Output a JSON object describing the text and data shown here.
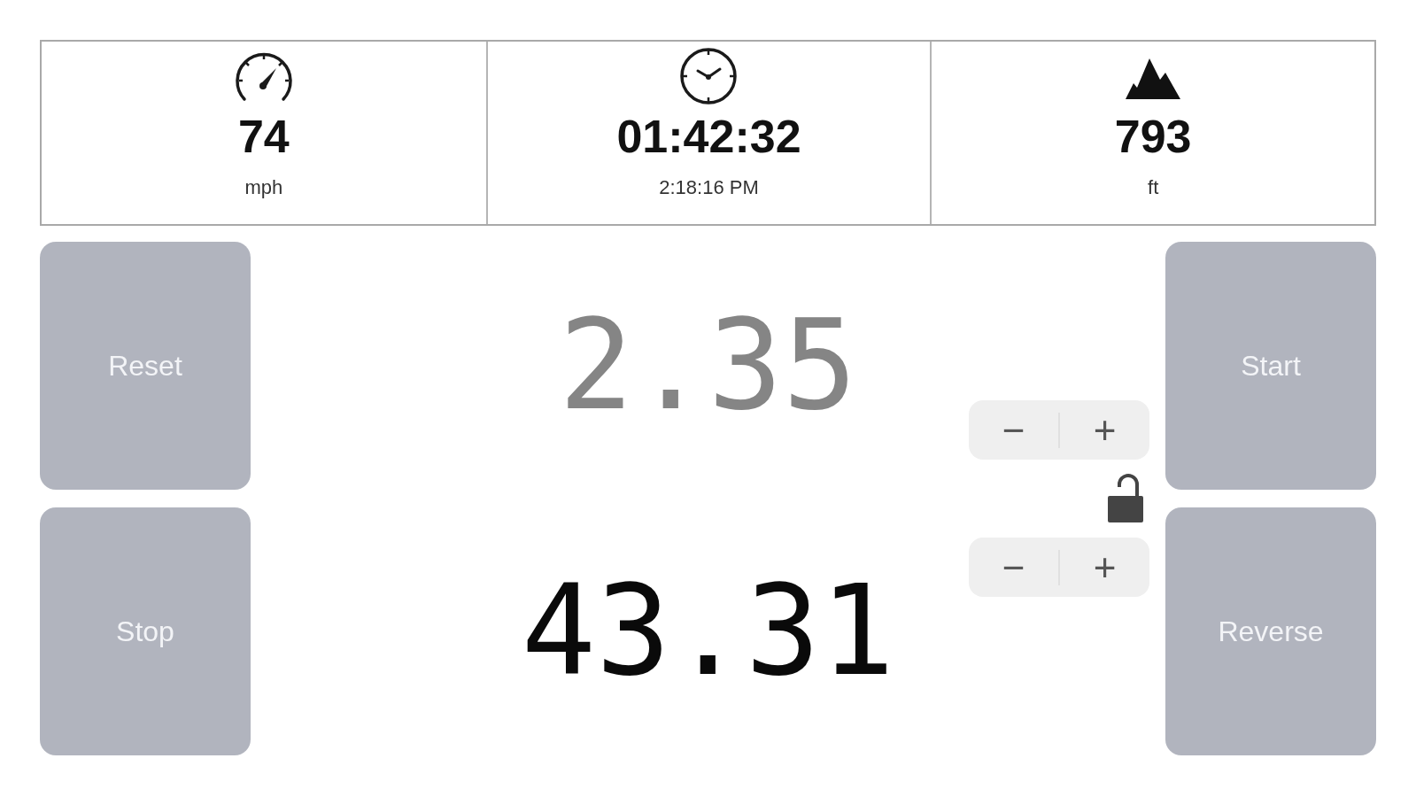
{
  "stats": [
    {
      "kind": "speed",
      "value": "74",
      "unit": "mph"
    },
    {
      "kind": "clock",
      "value": "01:42:32",
      "unit": "2:18:16 PM"
    },
    {
      "kind": "elevation",
      "value": "793",
      "unit": "ft"
    }
  ],
  "left_buttons": [
    "Reset",
    "Stop"
  ],
  "readouts": [
    {
      "value": "2.35",
      "dimmed": true
    },
    {
      "value": "43.31",
      "dimmed": false
    }
  ],
  "steppers": [
    {
      "minus": "−",
      "plus": "+"
    },
    {
      "minus": "−",
      "plus": "+"
    }
  ],
  "lock": {
    "locked": false
  },
  "right_buttons": [
    "Start",
    "Reverse"
  ]
}
